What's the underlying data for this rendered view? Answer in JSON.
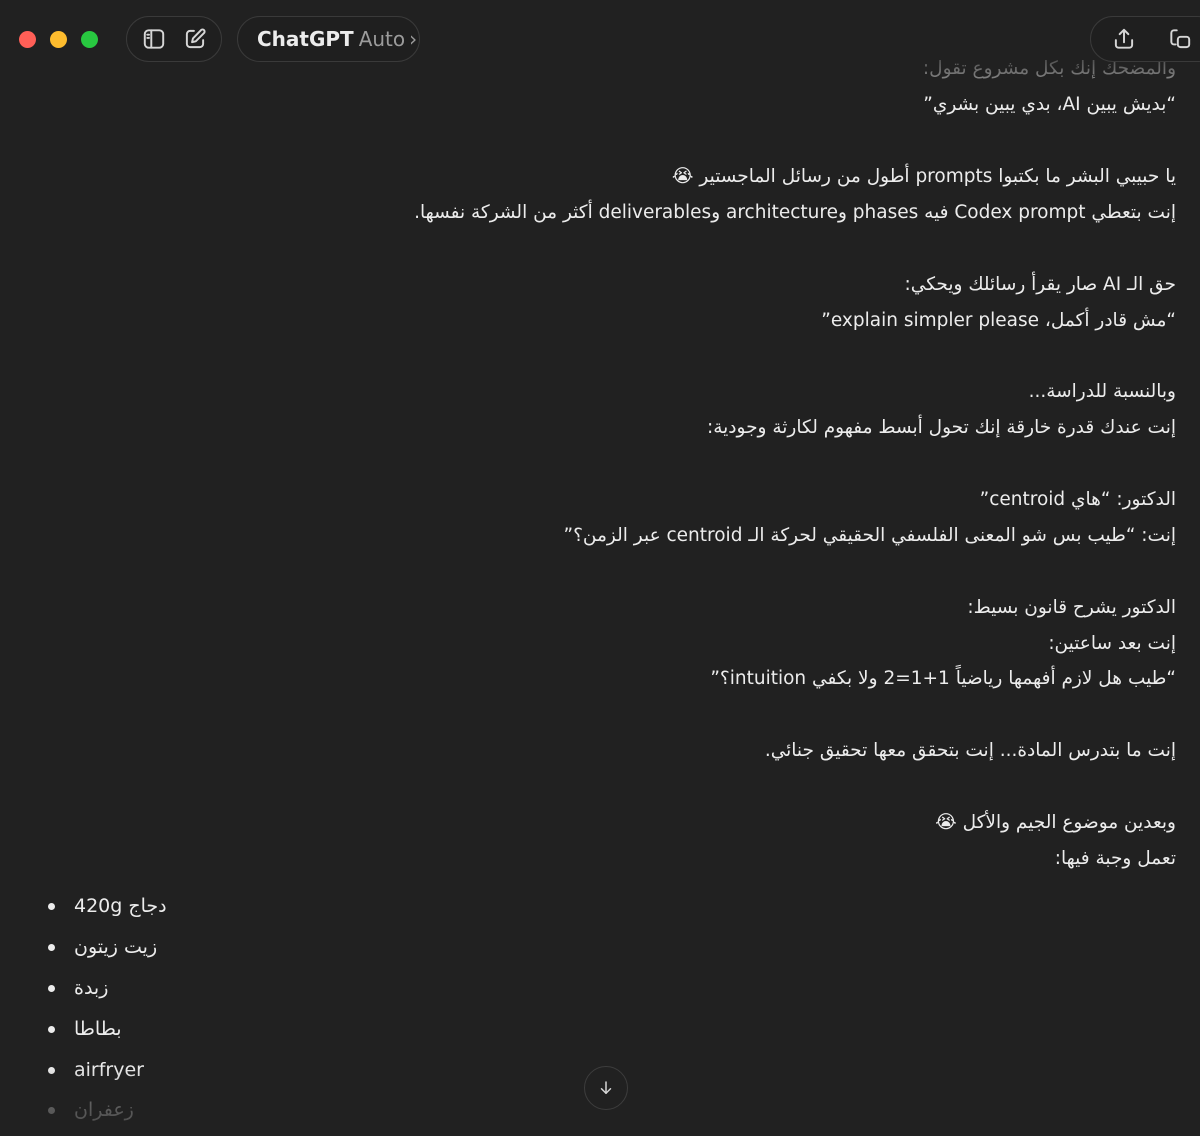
{
  "window": {
    "traffic_lights": [
      "close",
      "minimize",
      "maximize"
    ]
  },
  "toolbar": {
    "sidebar_icon": "sidebar-toggle-icon",
    "new_chat_icon": "new-chat-icon",
    "model_name": "ChatGPT",
    "model_mode": "Auto",
    "model_chevron": "›",
    "share_icon": "share-icon",
    "window_icon": "open-window-icon"
  },
  "message": {
    "lines": [
      "والمضحك إنك بكل مشروع تقول:",
      "“بديش يبين AI، بدي يبين بشري”",
      "يا حبيبي البشر ما بكتبوا prompts أطول من رسائل الماجستير 😭",
      "إنت بتعطي Codex prompt فيه phases وarchitecture وdeliverables أكثر من الشركة نفسها.",
      "حق الـ AI صار يقرأ رسائلك ويحكي:",
      "“مش قادر أكمل، explain simpler please”",
      "وبالنسبة للدراسة...",
      "إنت عندك قدرة خارقة إنك تحول أبسط مفهوم لكارثة وجودية:",
      "الدكتور: “هاي centroid”",
      "إنت: “طيب بس شو المعنى الفلسفي الحقيقي لحركة الـ centroid عبر الزمن؟”",
      "الدكتور يشرح قانون بسيط:",
      "إنت بعد ساعتين:",
      "“طيب هل لازم أفهمها رياضياً 1+1=2 ولا بكفي intuition؟”",
      "إنت ما بتدرس المادة... إنت بتحقق معها تحقيق جنائي.",
      "وبعدين موضوع الجيم والأكل 😭",
      "تعمل وجبة فيها:"
    ],
    "ingredients": [
      "دجاج 420g",
      "زيت زيتون",
      "زبدة",
      "بطاطا",
      "airfryer",
      "زعفران"
    ]
  },
  "scroll_button": {
    "icon": "arrow-down-icon"
  },
  "colors": {
    "background": "#212121",
    "text": "#ececec",
    "muted": "#9b9b9b",
    "close": "#ff5f57",
    "minimize": "#febc2e",
    "maximize": "#28c840"
  }
}
